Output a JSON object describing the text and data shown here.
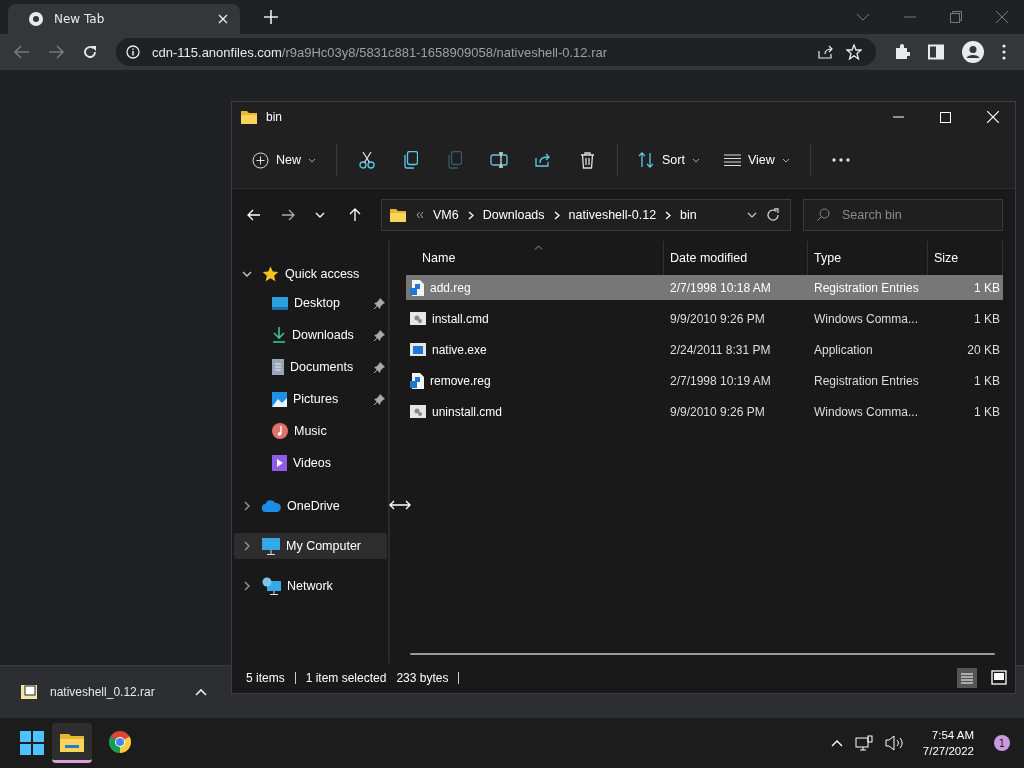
{
  "browser": {
    "tab_title": "New Tab",
    "address_host": "cdn-115.anonfiles.com",
    "address_path": "/r9a9Hc03y8/5831c881-1658909058/nativeshell-0.12.rar"
  },
  "download": {
    "file": "nativeshell_0.12.rar"
  },
  "explorer": {
    "title": "bin",
    "commands": [
      {
        "kind": "new",
        "label": "New",
        "disabled": false
      },
      {
        "kind": "cut",
        "disabled": false
      },
      {
        "kind": "copy",
        "disabled": false
      },
      {
        "kind": "paste",
        "disabled": true
      },
      {
        "kind": "rename",
        "disabled": false
      },
      {
        "kind": "share",
        "disabled": false
      },
      {
        "kind": "delete",
        "disabled": false
      },
      {
        "kind": "sort",
        "label": "Sort",
        "disabled": false
      },
      {
        "kind": "view",
        "label": "View",
        "disabled": false
      },
      {
        "kind": "more",
        "disabled": false
      }
    ],
    "breadcrumb": [
      "VM6",
      "Downloads",
      "nativeshell-0.12",
      "bin"
    ],
    "search": {
      "placeholder": "Search bin"
    },
    "nav": [
      {
        "label": "Quick access",
        "kind": "star",
        "expanded": true,
        "selected": false,
        "children": [
          {
            "label": "Desktop",
            "kind": "desktop",
            "pinned": true
          },
          {
            "label": "Downloads",
            "kind": "downloads",
            "pinned": true
          },
          {
            "label": "Documents",
            "kind": "documents",
            "pinned": true
          },
          {
            "label": "Pictures",
            "kind": "pictures",
            "pinned": true
          },
          {
            "label": "Music",
            "kind": "music",
            "pinned": false
          },
          {
            "label": "Videos",
            "kind": "videos",
            "pinned": false
          }
        ]
      },
      {
        "label": "OneDrive",
        "kind": "cloud",
        "expanded": false,
        "selected": false
      },
      {
        "label": "My Computer",
        "kind": "computer",
        "expanded": false,
        "selected": true
      },
      {
        "label": "Network",
        "kind": "network",
        "expanded": false,
        "selected": false
      }
    ],
    "columns": [
      "Name",
      "Date modified",
      "Type",
      "Size"
    ],
    "rows": [
      {
        "kind": "reg",
        "name": "add.reg",
        "date": "2/7/1998 10:18 AM",
        "type": "Registration Entries",
        "size": "1 KB",
        "selected": true
      },
      {
        "kind": "cmd",
        "name": "install.cmd",
        "date": "9/9/2010 9:26 PM",
        "type": "Windows Comma...",
        "size": "1 KB",
        "selected": false
      },
      {
        "kind": "exe",
        "name": "native.exe",
        "date": "2/24/2011 8:31 PM",
        "type": "Application",
        "size": "20 KB",
        "selected": false
      },
      {
        "kind": "reg",
        "name": "remove.reg",
        "date": "2/7/1998 10:19 AM",
        "type": "Registration Entries",
        "size": "1 KB",
        "selected": false
      },
      {
        "kind": "cmd",
        "name": "uninstall.cmd",
        "date": "9/9/2010 9:26 PM",
        "type": "Windows Comma...",
        "size": "1 KB",
        "selected": false
      }
    ],
    "status": [
      "5 items",
      "1 item selected",
      "233 bytes"
    ]
  },
  "taskbar": {
    "time": "7:54 AM",
    "date": "7/27/2022",
    "notifications": "1"
  }
}
